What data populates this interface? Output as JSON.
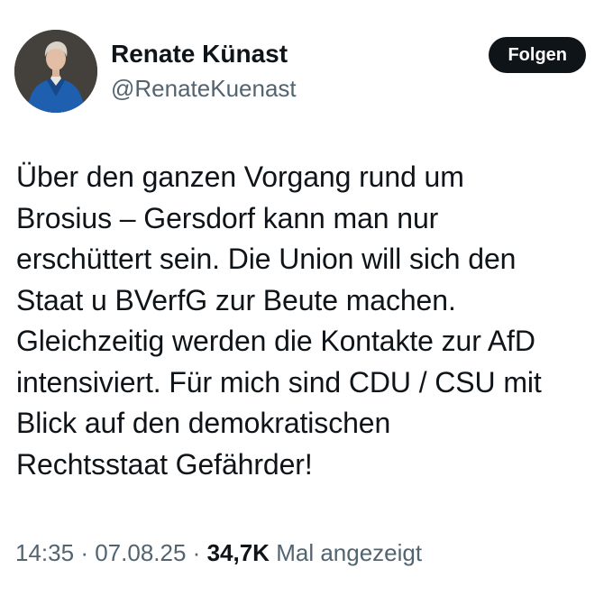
{
  "author": {
    "display_name": "Renate Künast",
    "handle": "@RenateKuenast",
    "avatar_icon": "profile-photo"
  },
  "follow_button": {
    "label": "Folgen"
  },
  "tweet": {
    "text": "Über den ganzen Vorgang rund um\nBrosius – Gersdorf kann man nur\nerschüttert sein. Die Union will sich den\nStaat u BVerfG  zur Beute machen.\nGleichzeitig werden die Kontakte zur AfD\nintensiviert. Für mich sind CDU / CSU mit\nBlick auf den demokratischen\nRechtsstaat Gefährder!"
  },
  "meta": {
    "time": "14:35",
    "separator": "·",
    "date": "07.08.25",
    "views_count": "34,7K",
    "views_label": "Mal angezeigt"
  },
  "colors": {
    "text_primary": "#0f1419",
    "text_secondary": "#536471",
    "button_bg": "#0f1419",
    "button_text": "#ffffff",
    "avatar_jacket": "#1f5fb0"
  }
}
